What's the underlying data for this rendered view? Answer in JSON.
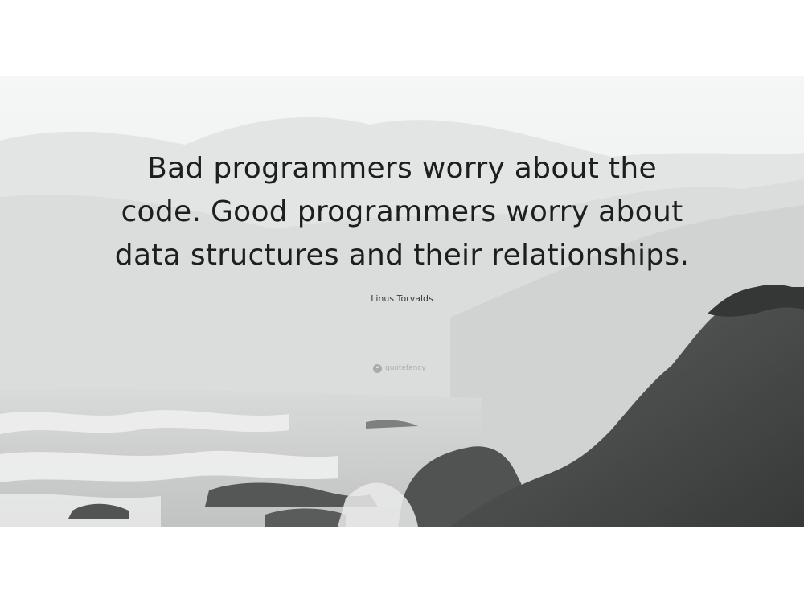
{
  "quote": {
    "lines": [
      "Bad programmers worry about the",
      "code. Good programmers worry about",
      "data structures and their relationships."
    ],
    "author": "Linus Torvalds"
  },
  "watermark": {
    "text": "quotefancy",
    "icon": "quote-mark-icon"
  },
  "colors": {
    "background": "#ffffff",
    "sky": "#eef0f0",
    "cliff": "#2a2c2c",
    "text": "#1e1e1e"
  }
}
